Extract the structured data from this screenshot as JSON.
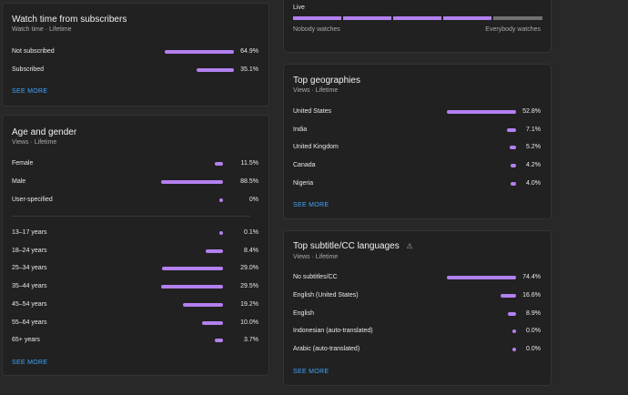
{
  "watch_subscribers": {
    "title": "Watch time from subscribers",
    "subtitle": "Watch time · Lifetime",
    "rows": [
      {
        "label": "Not subscribed",
        "value": "64.9%",
        "pct": 64.9
      },
      {
        "label": "Subscribed",
        "value": "35.1%",
        "pct": 35.1
      }
    ],
    "see_more": "SEE MORE"
  },
  "age_gender": {
    "title": "Age and gender",
    "subtitle": "Views · Lifetime",
    "gender_rows": [
      {
        "label": "Female",
        "value": "11.5%",
        "pct": 11.5
      },
      {
        "label": "Male",
        "value": "88.5%",
        "pct": 88.5
      },
      {
        "label": "User-specified",
        "value": "0%",
        "pct": 0
      }
    ],
    "age_rows": [
      {
        "label": "13–17 years",
        "value": "0.1%",
        "pct": 0.1
      },
      {
        "label": "18–24 years",
        "value": "8.4%",
        "pct": 8.4
      },
      {
        "label": "25–34 years",
        "value": "29.0%",
        "pct": 29.0
      },
      {
        "label": "35–44 years",
        "value": "29.5%",
        "pct": 29.5
      },
      {
        "label": "45–54 years",
        "value": "19.2%",
        "pct": 19.2
      },
      {
        "label": "55–64 years",
        "value": "10.0%",
        "pct": 10.0
      },
      {
        "label": "65+ years",
        "value": "3.7%",
        "pct": 3.7
      }
    ],
    "see_more": "SEE MORE"
  },
  "live": {
    "label": "Live",
    "left_label": "Nobody watches",
    "right_label": "Everybody watches",
    "filled_segments": 4,
    "total_segments": 5
  },
  "geographies": {
    "title": "Top geographies",
    "subtitle": "Views · Lifetime",
    "rows": [
      {
        "label": "United States",
        "value": "52.8%",
        "pct": 52.8
      },
      {
        "label": "India",
        "value": "7.1%",
        "pct": 7.1
      },
      {
        "label": "United Kingdom",
        "value": "5.2%",
        "pct": 5.2
      },
      {
        "label": "Canada",
        "value": "4.2%",
        "pct": 4.2
      },
      {
        "label": "Nigeria",
        "value": "4.0%",
        "pct": 4.0
      }
    ],
    "see_more": "SEE MORE"
  },
  "subtitles": {
    "title": "Top subtitle/CC languages",
    "warning_icon": "warning-icon",
    "subtitle": "Views · Lifetime",
    "rows": [
      {
        "label": "No subtitles/CC",
        "value": "74.4%",
        "pct": 74.4
      },
      {
        "label": "English (United States)",
        "value": "16.6%",
        "pct": 16.6
      },
      {
        "label": "English",
        "value": "8.9%",
        "pct": 8.9
      },
      {
        "label": "Indonesian (auto-translated)",
        "value": "0.0%",
        "pct": 0.0
      },
      {
        "label": "Arabic (auto-translated)",
        "value": "0.0%",
        "pct": 0.0
      }
    ],
    "see_more": "SEE MORE"
  },
  "colors": {
    "bar": "#b380f0",
    "bar_empty": "#717171",
    "link": "#3ea6ff"
  }
}
